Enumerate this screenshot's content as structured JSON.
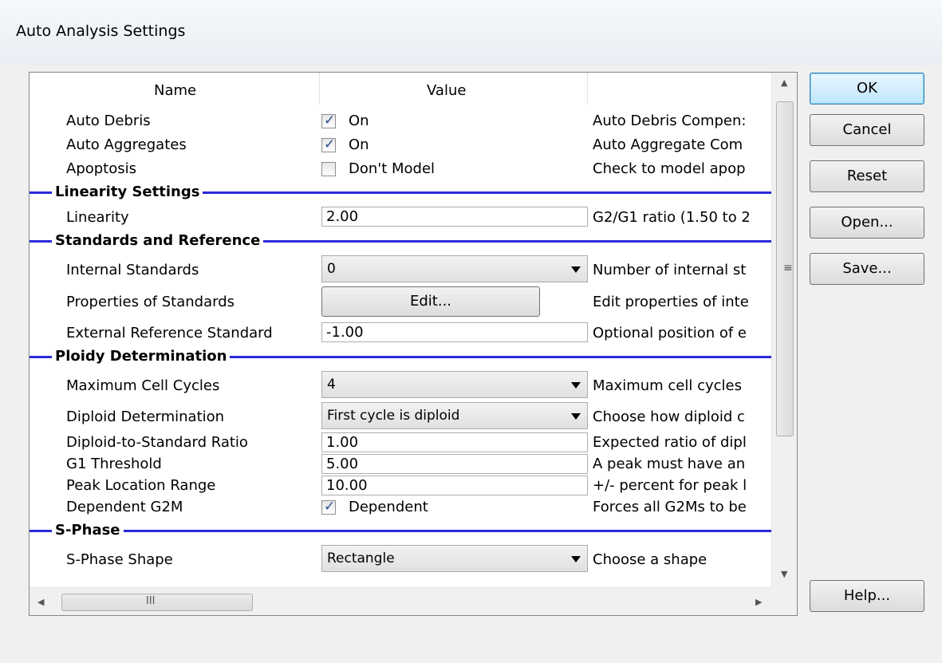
{
  "window": {
    "title": "Auto Analysis Settings"
  },
  "header": {
    "name": "Name",
    "value": "Value"
  },
  "rows": {
    "auto_debris": {
      "name": "Auto Debris",
      "value": "On",
      "checked": true,
      "desc": "Auto Debris Compen:"
    },
    "auto_aggregates": {
      "name": "Auto Aggregates",
      "value": "On",
      "checked": true,
      "desc": "Auto Aggregate Com"
    },
    "apoptosis": {
      "name": "Apoptosis",
      "value": "Don't Model",
      "checked": false,
      "desc": "Check to model apop"
    },
    "linearity": {
      "name": "Linearity",
      "value": "2.00",
      "desc": "G2/G1 ratio (1.50 to 2"
    },
    "internal_standards": {
      "name": "Internal Standards",
      "value": "0",
      "desc": "Number of internal st"
    },
    "properties_standards": {
      "name": "Properties of Standards",
      "value": "Edit...",
      "desc": "Edit properties of inte"
    },
    "external_reference": {
      "name": "External Reference Standard",
      "value": "-1.00",
      "desc": "Optional position of e"
    },
    "max_cell_cycles": {
      "name": "Maximum Cell Cycles",
      "value": "4",
      "desc": "Maximum cell cycles"
    },
    "diploid_determination": {
      "name": "Diploid Determination",
      "value": "First cycle is diploid",
      "desc": "Choose how diploid c"
    },
    "diploid_standard_ratio": {
      "name": "Diploid-to-Standard Ratio",
      "value": "1.00",
      "desc": "Expected ratio of dipl"
    },
    "g1_threshold": {
      "name": "G1 Threshold",
      "value": "5.00",
      "desc": "A peak must have an"
    },
    "peak_location_range": {
      "name": "Peak Location Range",
      "value": "10.00",
      "desc": "+/- percent for peak l"
    },
    "dependent_g2m": {
      "name": "Dependent G2M",
      "value": "Dependent",
      "checked": true,
      "desc": "Forces all G2Ms to be"
    },
    "s_phase_shape": {
      "name": "S-Phase Shape",
      "value": "Rectangle",
      "desc": "Choose a shape"
    }
  },
  "sections": {
    "linearity": "Linearity Settings",
    "standards": "Standards and Reference",
    "ploidy": "Ploidy Determination",
    "sphase": "S-Phase"
  },
  "scrollbar": {
    "grip": "≡",
    "hgrip": "III"
  },
  "buttons": {
    "ok": "OK",
    "cancel": "Cancel",
    "reset": "Reset",
    "open": "Open...",
    "save": "Save...",
    "help": "Help..."
  }
}
